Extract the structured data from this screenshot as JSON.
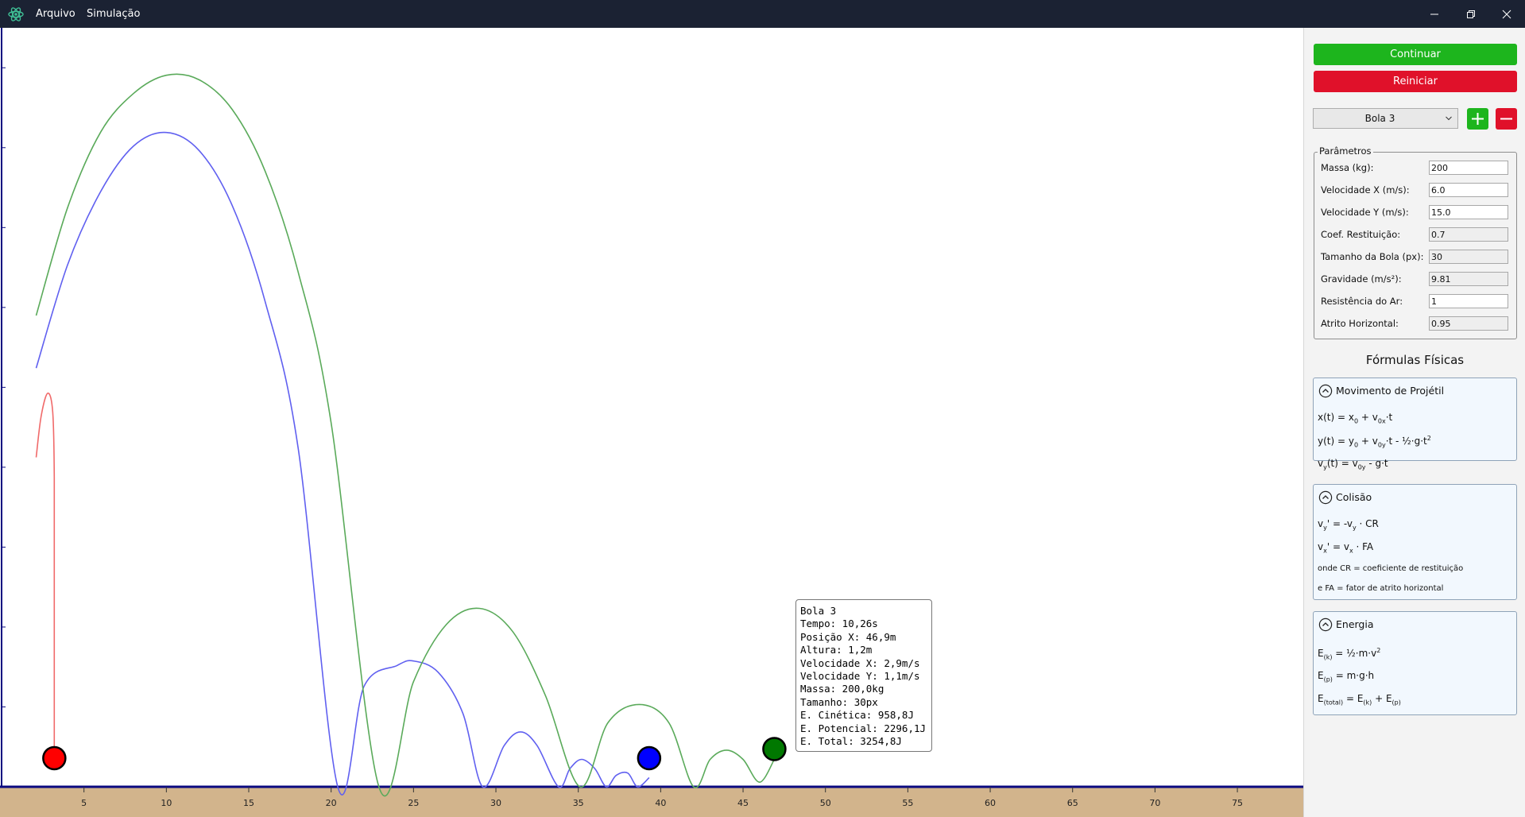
{
  "titlebar": {
    "menus": [
      "Arquivo",
      "Simulação"
    ]
  },
  "controls": {
    "continue_label": "Continuar",
    "restart_label": "Reiniciar",
    "selected_ball": "Bola 3",
    "continue_color": "#1db51d",
    "restart_color": "#e0112a"
  },
  "params": {
    "legend": "Parâmetros",
    "rows": [
      {
        "label": "Massa (kg):",
        "value": "200",
        "readonly": false
      },
      {
        "label": "Velocidade X (m/s):",
        "value": "6.0",
        "readonly": false
      },
      {
        "label": "Velocidade Y (m/s):",
        "value": "15.0",
        "readonly": false
      },
      {
        "label": "Coef. Restituição:",
        "value": "0.7",
        "readonly": true
      },
      {
        "label": "Tamanho da Bola (px):",
        "value": "30",
        "readonly": true
      },
      {
        "label": "Gravidade (m/s²):",
        "value": "9.81",
        "readonly": true
      },
      {
        "label": "Resistência do Ar:",
        "value": "1",
        "readonly": false
      },
      {
        "label": "Atrito Horizontal:",
        "value": "0.95",
        "readonly": true
      }
    ]
  },
  "formulas": {
    "title": "Fórmulas Físicas",
    "cards": [
      {
        "title": "Movimento de Projétil"
      },
      {
        "title": "Colisão",
        "notes": [
          "onde CR = coeficiente de restituição",
          "e FA = fator de atrito horizontal"
        ]
      },
      {
        "title": "Energia"
      }
    ]
  },
  "tooltip": {
    "lines": [
      "Bola 3",
      "Tempo: 10,26s",
      "Posição X: 46,9m",
      "Altura: 1,2m",
      "Velocidade X: 2,9m/s",
      "Velocidade Y: 1,1m/s",
      "Massa: 200,0kg",
      "Tamanho: 30px",
      "E. Cinética: 958,8J",
      "E. Potencial: 2296,1J",
      "E. Total: 3254,8J"
    ]
  },
  "chart_data": {
    "type": "line",
    "x_ticks": [
      5,
      10,
      15,
      20,
      25,
      30,
      35,
      40,
      45,
      50,
      55,
      60,
      65,
      70,
      75
    ],
    "xlim": [
      0,
      79
    ],
    "ylim": [
      0,
      33
    ],
    "ground_color": "#d2b48c",
    "axis_color": "#0a0a80",
    "balls": [
      {
        "color": "#ff0000",
        "trail_color": "#f06a6a",
        "position": [
          3.2,
          0.8
        ],
        "path": [
          [
            2.1,
            14.4
          ],
          [
            2.4,
            16.2
          ],
          [
            2.8,
            17.2
          ],
          [
            3.1,
            16.4
          ],
          [
            3.2,
            13.5
          ],
          [
            3.2,
            8.0
          ],
          [
            3.2,
            0.8
          ]
        ]
      },
      {
        "color": "#0000ff",
        "trail_color": "#6060f0",
        "position": [
          39.3,
          0.8
        ],
        "path": [
          [
            2.1,
            18.3
          ],
          [
            4.0,
            22.8
          ],
          [
            6.0,
            26.0
          ],
          [
            8.0,
            28.0
          ],
          [
            10.0,
            28.6
          ],
          [
            12.0,
            27.8
          ],
          [
            14.0,
            25.4
          ],
          [
            16.0,
            21.2
          ],
          [
            18.0,
            14.8
          ],
          [
            20.4,
            0.0
          ],
          [
            22.0,
            4.4
          ],
          [
            24.0,
            5.3
          ],
          [
            25.0,
            5.5
          ],
          [
            26.5,
            5.0
          ],
          [
            28.0,
            3.2
          ],
          [
            29.2,
            0.0
          ],
          [
            30.5,
            1.8
          ],
          [
            31.5,
            2.4
          ],
          [
            32.5,
            1.8
          ],
          [
            33.8,
            0.0
          ],
          [
            34.5,
            0.8
          ],
          [
            35.2,
            1.2
          ],
          [
            36.0,
            0.8
          ],
          [
            36.7,
            0.0
          ],
          [
            37.3,
            0.5
          ],
          [
            38.0,
            0.6
          ],
          [
            38.6,
            0.0
          ],
          [
            39.3,
            0.4
          ]
        ]
      },
      {
        "color": "#007800",
        "trail_color": "#5aaa5a",
        "position": [
          46.9,
          1.2
        ],
        "path": [
          [
            2.1,
            20.6
          ],
          [
            4.0,
            25.3
          ],
          [
            6.0,
            28.6
          ],
          [
            8.0,
            30.3
          ],
          [
            10.0,
            31.1
          ],
          [
            12.0,
            30.9
          ],
          [
            14.0,
            29.6
          ],
          [
            16.0,
            26.9
          ],
          [
            18.0,
            22.5
          ],
          [
            20.0,
            15.9
          ],
          [
            22.9,
            0.0
          ],
          [
            25.0,
            4.6
          ],
          [
            27.0,
            7.1
          ],
          [
            29.0,
            7.8
          ],
          [
            31.0,
            6.8
          ],
          [
            33.0,
            4.0
          ],
          [
            35.1,
            0.0
          ],
          [
            36.8,
            2.8
          ],
          [
            38.7,
            3.6
          ],
          [
            40.5,
            2.8
          ],
          [
            42.0,
            0.0
          ],
          [
            43.0,
            1.2
          ],
          [
            44.0,
            1.6
          ],
          [
            45.0,
            1.2
          ],
          [
            46.0,
            0.2
          ],
          [
            46.9,
            1.2
          ]
        ]
      }
    ]
  }
}
